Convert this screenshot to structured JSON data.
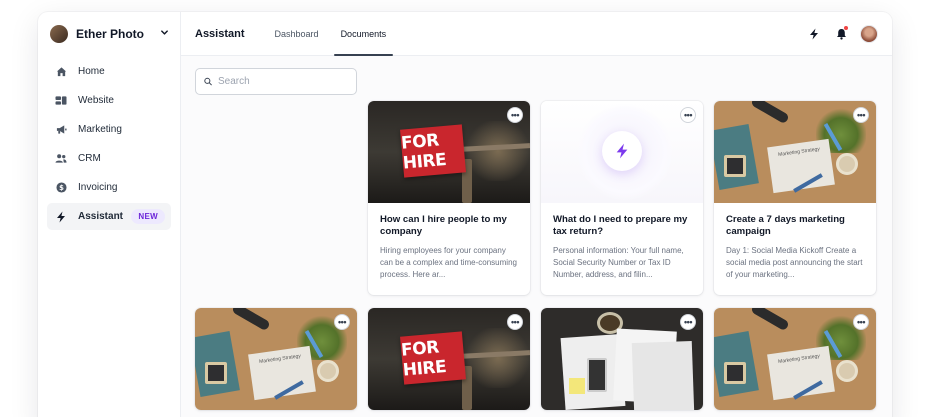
{
  "sidebar": {
    "workspace_name": "Ether Photo",
    "chevron_icon": "chevron-down-icon",
    "items": [
      {
        "label": "Home",
        "icon": "home-icon"
      },
      {
        "label": "Website",
        "icon": "website-icon"
      },
      {
        "label": "Marketing",
        "icon": "megaphone-icon"
      },
      {
        "label": "CRM",
        "icon": "users-icon"
      },
      {
        "label": "Invoicing",
        "icon": "dollar-icon"
      },
      {
        "label": "Assistant",
        "icon": "bolt-icon",
        "badge": "NEW",
        "active": true
      }
    ]
  },
  "topbar": {
    "title": "Assistant",
    "tabs": [
      {
        "label": "Dashboard",
        "active": false
      },
      {
        "label": "Documents",
        "active": true
      }
    ]
  },
  "search": {
    "placeholder": "Search",
    "value": ""
  },
  "cards": [
    {
      "image": "for-hire-sign",
      "thumb_text": "FOR HIRE",
      "title": "How can I hire people to my company",
      "excerpt": "Hiring employees for your company can be a complex and time-consuming process. Here ar..."
    },
    {
      "image": "assistant-bolt",
      "title": "What do I need to prepare my tax return?",
      "excerpt": "Personal information: Your full name, Social Security Number or Tax ID Number, address, and filin..."
    },
    {
      "image": "marketing-desk",
      "thumb_text": "Marketing Strategy",
      "title": "Create a 7 days marketing campaign",
      "excerpt": "Day 1: Social Media Kickoff Create a social media post announcing the start of your marketing..."
    },
    {
      "image": "marketing-desk",
      "thumb_text": "Marketing Strategy"
    },
    {
      "image": "for-hire-sign",
      "thumb_text": "FOR HIRE"
    },
    {
      "image": "tax-documents"
    },
    {
      "image": "marketing-desk",
      "thumb_text": "Marketing Strategy"
    }
  ],
  "colors": {
    "accent": "#7c3aed",
    "badge_bg": "#ede9fe",
    "notification": "#ef4444"
  }
}
